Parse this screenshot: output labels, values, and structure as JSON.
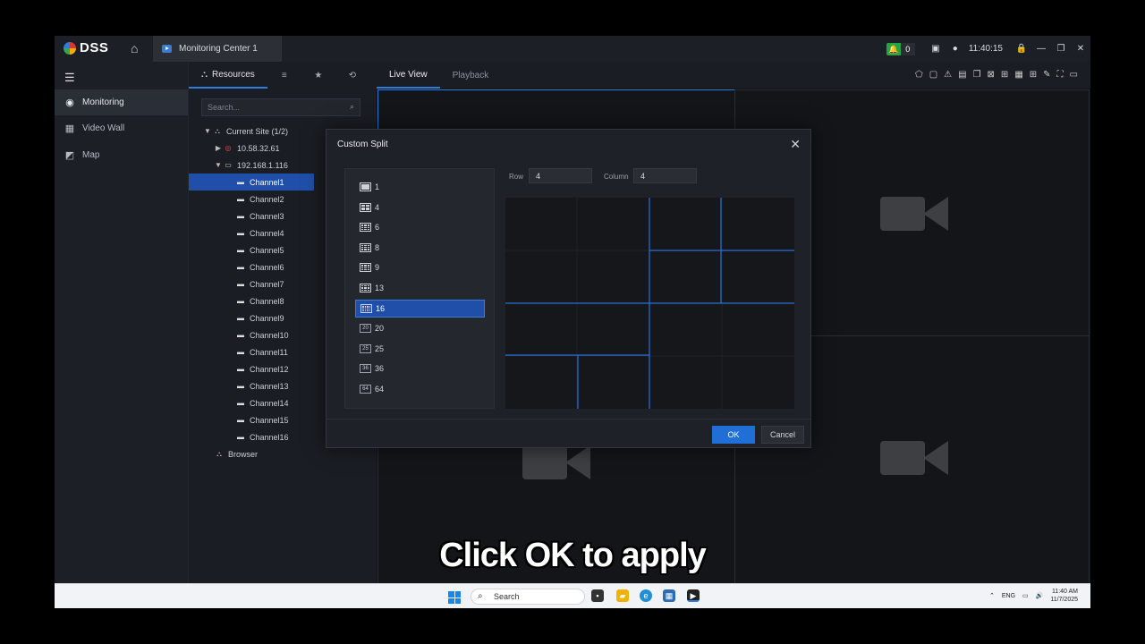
{
  "app": {
    "name": "DSS",
    "tab": "Monitoring Center 1",
    "alarm_count": "0",
    "clock": "11:40:15"
  },
  "nav": {
    "items": [
      {
        "label": "Monitoring",
        "icon": "monitoring-icon"
      },
      {
        "label": "Video Wall",
        "icon": "video-wall-icon"
      },
      {
        "label": "Map",
        "icon": "map-icon"
      }
    ]
  },
  "resources": {
    "tab_label": "Resources",
    "search_placeholder": "Search...",
    "tree": {
      "site": "Current Site (1/2)",
      "device1": "10.58.32.61",
      "device2": "192.168.1.116",
      "channels": [
        "Channel1",
        "Channel2",
        "Channel3",
        "Channel4",
        "Channel5",
        "Channel6",
        "Channel7",
        "Channel8",
        "Channel9",
        "Channel10",
        "Channel11",
        "Channel12",
        "Channel13",
        "Channel14",
        "Channel15",
        "Channel16"
      ],
      "browser": "Browser"
    }
  },
  "view": {
    "tabs": [
      "Live View",
      "Playback"
    ]
  },
  "dialog": {
    "title": "Custom Split",
    "splits": [
      "1",
      "4",
      "6",
      "8",
      "9",
      "13",
      "16",
      "20",
      "25",
      "36",
      "64"
    ],
    "selected_split": "16",
    "row_label": "Row",
    "row_value": "4",
    "column_label": "Column",
    "column_value": "4",
    "ok": "OK",
    "cancel": "Cancel"
  },
  "caption": "Click OK to apply",
  "taskbar": {
    "search": "Search",
    "lang": "ENG",
    "time": "11:40 AM",
    "date": "11/7/2025"
  }
}
